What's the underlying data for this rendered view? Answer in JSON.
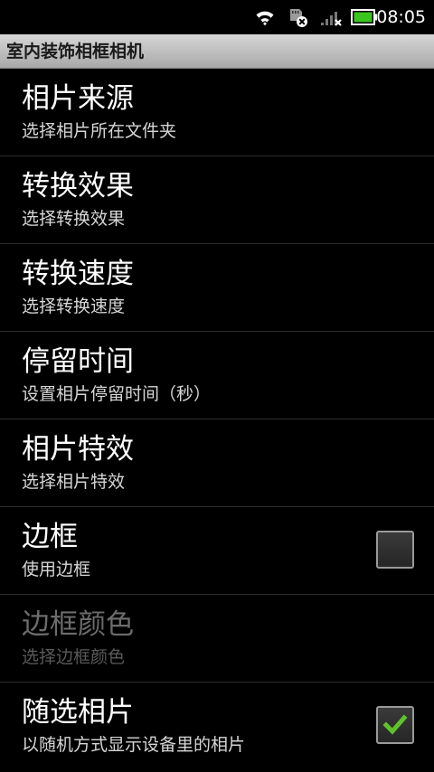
{
  "status_bar": {
    "time": "08:05",
    "battery_color": "#3ac41f"
  },
  "app": {
    "title": "室内装饰相框相机"
  },
  "preferences": [
    {
      "title": "相片来源",
      "summary": "选择相片所在文件夹",
      "enabled": true
    },
    {
      "title": "转换效果",
      "summary": "选择转换效果",
      "enabled": true
    },
    {
      "title": "转换速度",
      "summary": "选择转换速度",
      "enabled": true
    },
    {
      "title": "停留时间",
      "summary": "设置相片停留时间（秒）",
      "enabled": true
    },
    {
      "title": "相片特效",
      "summary": "选择相片特效",
      "enabled": true
    },
    {
      "title": "边框",
      "summary": "使用边框",
      "enabled": true,
      "checked": false
    },
    {
      "title": "边框颜色",
      "summary": "选择边框颜色",
      "enabled": false
    },
    {
      "title": "随选相片",
      "summary": "以随机方式显示设备里的相片",
      "enabled": true,
      "checked": true
    }
  ],
  "colors": {
    "check_mark": "#5fc22a"
  }
}
